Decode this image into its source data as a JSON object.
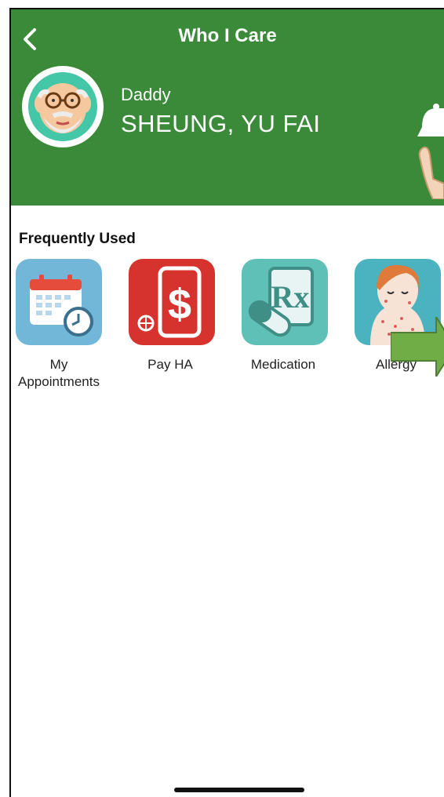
{
  "header": {
    "title": "Who I Care",
    "relation": "Daddy",
    "patient_name": "SHEUNG, YU FAI",
    "background_color": "#3a8a3a"
  },
  "section": {
    "title": "Frequently Used"
  },
  "apps": [
    {
      "label": "My\nAppointments",
      "icon": "calendar-clock-icon"
    },
    {
      "label": "Pay HA",
      "icon": "pay-ha-icon"
    },
    {
      "label": "Medication",
      "icon": "rx-pill-icon"
    },
    {
      "label": "Allergy",
      "icon": "allergy-icon"
    }
  ],
  "colors": {
    "accent_green": "#3a8a3a",
    "arrow_green": "#70ad47"
  }
}
